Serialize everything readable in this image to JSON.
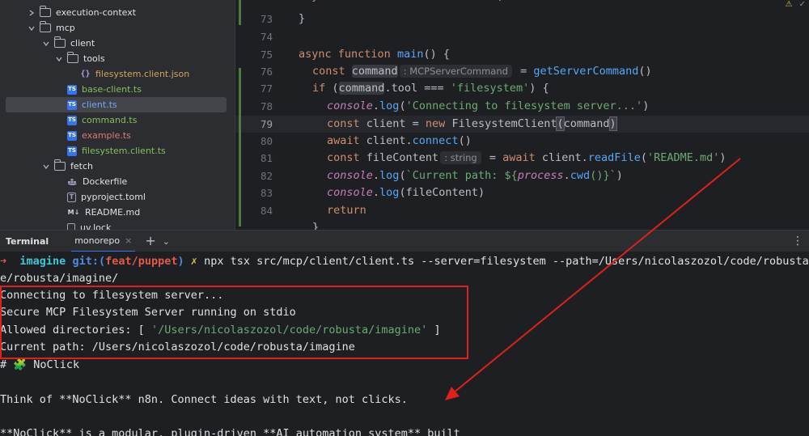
{
  "project_tree": {
    "items": [
      {
        "label": "execution-context",
        "kind": "folder",
        "expanded": false,
        "depth": 1
      },
      {
        "label": "mcp",
        "kind": "folder",
        "expanded": true,
        "depth": 1
      },
      {
        "label": "client",
        "kind": "folder",
        "expanded": true,
        "depth": 2
      },
      {
        "label": "tools",
        "kind": "folder",
        "expanded": true,
        "depth": 3
      },
      {
        "label": "filesystem.client.json",
        "kind": "json",
        "depth": 4
      },
      {
        "label": "base-client.ts",
        "kind": "ts",
        "depth": 3
      },
      {
        "label": "client.ts",
        "kind": "ts",
        "depth": 3,
        "selected": true
      },
      {
        "label": "command.ts",
        "kind": "ts",
        "depth": 3
      },
      {
        "label": "example.ts",
        "kind": "ts",
        "depth": 3
      },
      {
        "label": "filesystem.client.ts",
        "kind": "ts",
        "depth": 3
      },
      {
        "label": "fetch",
        "kind": "folder",
        "expanded": true,
        "depth": 2
      },
      {
        "label": "Dockerfile",
        "kind": "docker",
        "depth": 3
      },
      {
        "label": "pyproject.toml",
        "kind": "toml",
        "depth": 3
      },
      {
        "label": "README.md",
        "kind": "md",
        "depth": 3
      },
      {
        "label": "uv.lock",
        "kind": "txt",
        "depth": 3
      }
    ]
  },
  "editor": {
    "line_numbers": [
      "73",
      "74",
      "75",
      "76",
      "77",
      "78",
      "79",
      "80",
      "81",
      "82",
      "83",
      "84"
    ],
    "current_line": "79",
    "top_partial": "async function saveToolsToFile(",
    "lines": {
      "l73": "}",
      "l75_kw": "async function",
      "l75_fn": "main",
      "l75_rest": "() {",
      "l76_kw": "const",
      "l76_var": "command",
      "l76_hint": ": MCPServerCommand",
      "l76_eq": " = ",
      "l76_fn": "getServerCommand",
      "l76_rest": "()",
      "l77_kw": "if",
      "l77_a": " (",
      "l77_var": "command",
      "l77_b": ".tool === ",
      "l77_str": "'filesystem'",
      "l77_c": ") {",
      "l78_obj": "console",
      "l78_dot": ".",
      "l78_fn": "log",
      "l78_a": "(",
      "l78_str": "'Connecting to filesystem server...'",
      "l78_b": ")",
      "l79_kw": "const",
      "l79_a": " client = ",
      "l79_kw2": "new",
      "l79_b": " FilesystemClient",
      "l79_br1": "(",
      "l79_c": "command",
      "l79_br2": ")",
      "l80_kw": "await",
      "l80_a": " client.",
      "l80_fn": "connect",
      "l80_b": "()",
      "l81_kw": "const",
      "l81_a": " fileContent",
      "l81_hint": ": string",
      "l81_b": " = ",
      "l81_kw2": "await",
      "l81_c": " client.",
      "l81_fn": "readFile",
      "l81_d": "(",
      "l81_str": "'README.md'",
      "l81_e": ")",
      "l82_obj": "console",
      "l82_dot": ".",
      "l82_fn": "log",
      "l82_a": "(",
      "l82_str": "`Current path: ${",
      "l82_proc": "process",
      "l82_dot2": ".",
      "l82_fn2": "cwd",
      "l82_str2": "()}`",
      "l82_b": ")",
      "l83_obj": "console",
      "l83_dot": ".",
      "l83_fn": "log",
      "l83_a": "(fileContent)",
      "l84_kw": "return",
      "l85": "}"
    }
  },
  "terminal_tabs": {
    "title": "Terminal",
    "tab": "monorepo",
    "close": "×",
    "plus": "+",
    "chevron": "⌄",
    "more": "⋮"
  },
  "terminal": {
    "prompt_arrow": "➜",
    "dir": "imagine",
    "git_label": "git:(",
    "branch": "feat/puppet",
    "git_close": ")",
    "dirty": "✗",
    "command": "npx tsx src/mcp/client/client.ts --server=filesystem --path=/Users/nicolaszozol/code/robusta/imagine/",
    "command_wrap": "e/robusta/imagine/",
    "out1": "Connecting to filesystem server...",
    "out2": "Secure MCP Filesystem Server running on stdio",
    "out3_a": "Allowed directories: [ ",
    "out3_str": "'/Users/nicolaszozol/code/robusta/imagine'",
    "out3_b": " ]",
    "out4": "Current path: /Users/nicolaszozol/code/robusta/imagine",
    "out5_hash": "# ",
    "out5_icon": "🧩",
    "out5_title": " NoClick",
    "out6": "Think of **NoClick** n8n. Connect ideas with text, not clicks.",
    "out7": "**NoClick** is a modular, plugin-driven **AI automation system** built"
  },
  "annotation": {
    "box_color": "#e0201b",
    "arrow_color": "#e0201b"
  }
}
